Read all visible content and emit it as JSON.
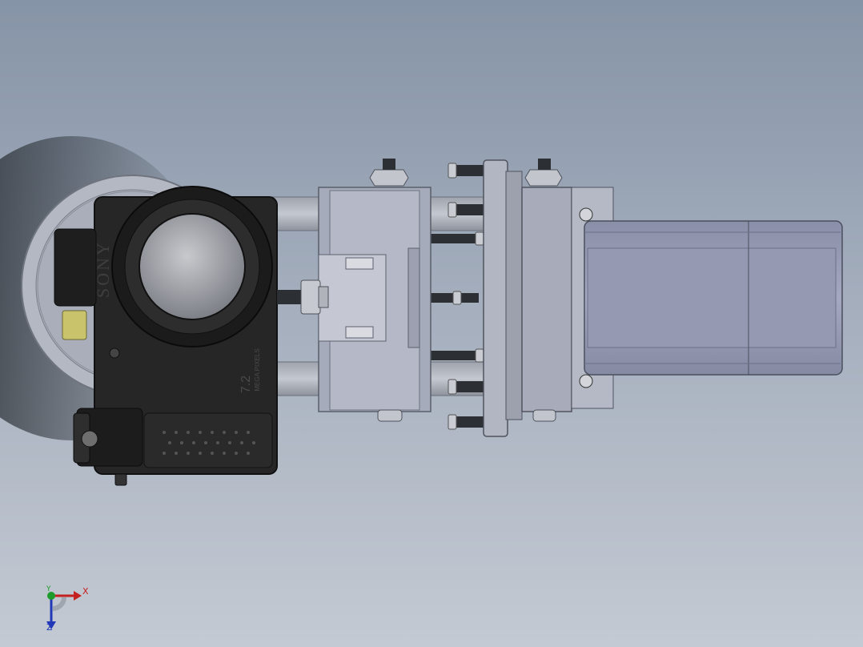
{
  "viewport": {
    "background_top": "#8694a7",
    "background_bottom": "#c4cad3"
  },
  "model": {
    "camera_brand": "SONY",
    "megapixels": "7.2",
    "megapixel_label": "MEGA PIXELS"
  },
  "triad": {
    "x_label": "X",
    "y_label": "Y",
    "z_label": "Z",
    "x_color": "#c42020",
    "y_color": "#1e9b2a",
    "z_color": "#2038b8"
  }
}
